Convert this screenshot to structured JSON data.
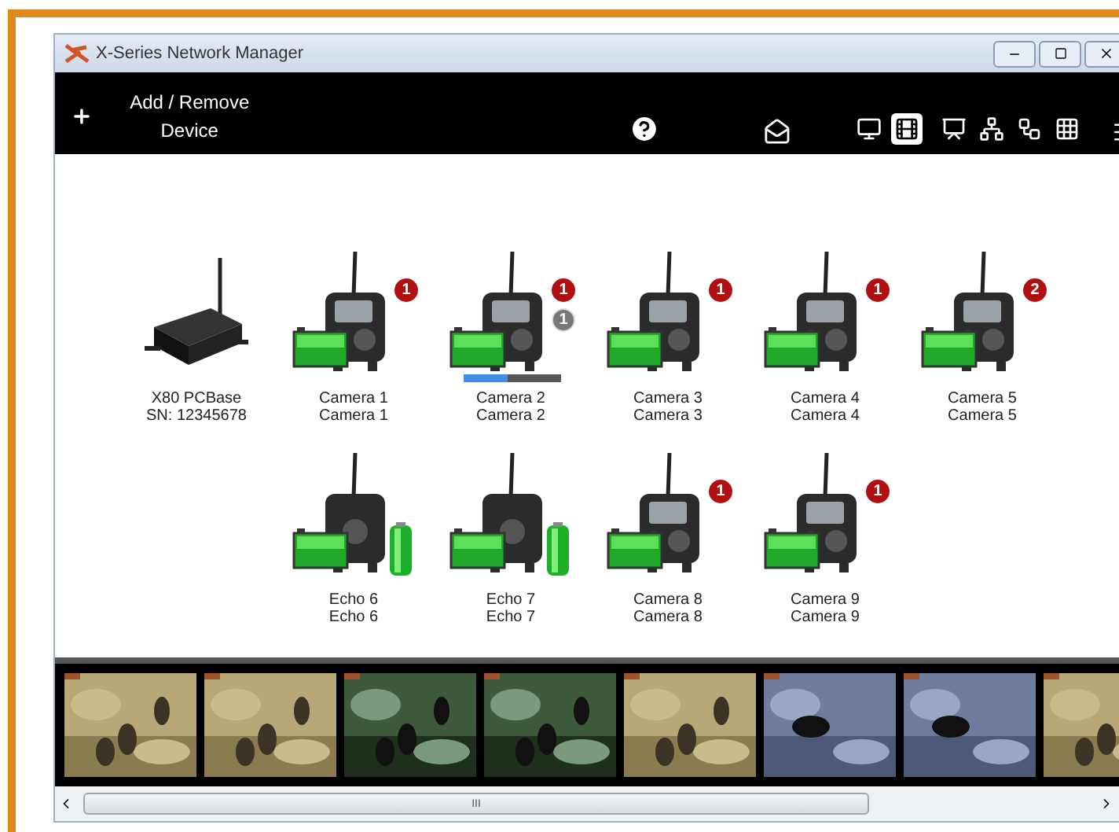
{
  "window": {
    "title": "X-Series Network Manager"
  },
  "toolbar": {
    "add_button": "Add / Remove Device",
    "views": [
      {
        "kind": "monitor",
        "selected": false
      },
      {
        "kind": "film",
        "selected": true
      },
      {
        "kind": "presentation",
        "selected": false
      },
      {
        "kind": "network",
        "selected": false
      },
      {
        "kind": "tree",
        "selected": false
      },
      {
        "kind": "grid",
        "selected": false
      }
    ]
  },
  "devices": [
    {
      "kind": "base",
      "lines": [
        "X80 PCBase",
        "SN: 12345678"
      ]
    },
    {
      "kind": "camera",
      "lines": [
        "Camera 1",
        "Camera 1"
      ],
      "alert": "1"
    },
    {
      "kind": "camera",
      "lines": [
        "Camera 2",
        "Camera 2"
      ],
      "alert": "1",
      "pending": "1",
      "level": 0.45
    },
    {
      "kind": "camera",
      "lines": [
        "Camera 3",
        "Camera 3"
      ],
      "alert": "1"
    },
    {
      "kind": "camera",
      "lines": [
        "Camera 4",
        "Camera 4"
      ],
      "alert": "1"
    },
    {
      "kind": "camera",
      "lines": [
        "Camera 5",
        "Camera 5"
      ],
      "alert": "2"
    },
    {
      "kind": "echo",
      "lines": [
        "Echo 6",
        "Echo 6"
      ]
    },
    {
      "kind": "echo",
      "lines": [
        "Echo 7",
        "Echo 7"
      ]
    },
    {
      "kind": "camera",
      "lines": [
        "Camera 8",
        "Camera 8"
      ],
      "alert": "1"
    },
    {
      "kind": "camera",
      "lines": [
        "Camera 9",
        "Camera 9"
      ],
      "alert": "1"
    }
  ],
  "scrollbar": {
    "grip": "III"
  }
}
